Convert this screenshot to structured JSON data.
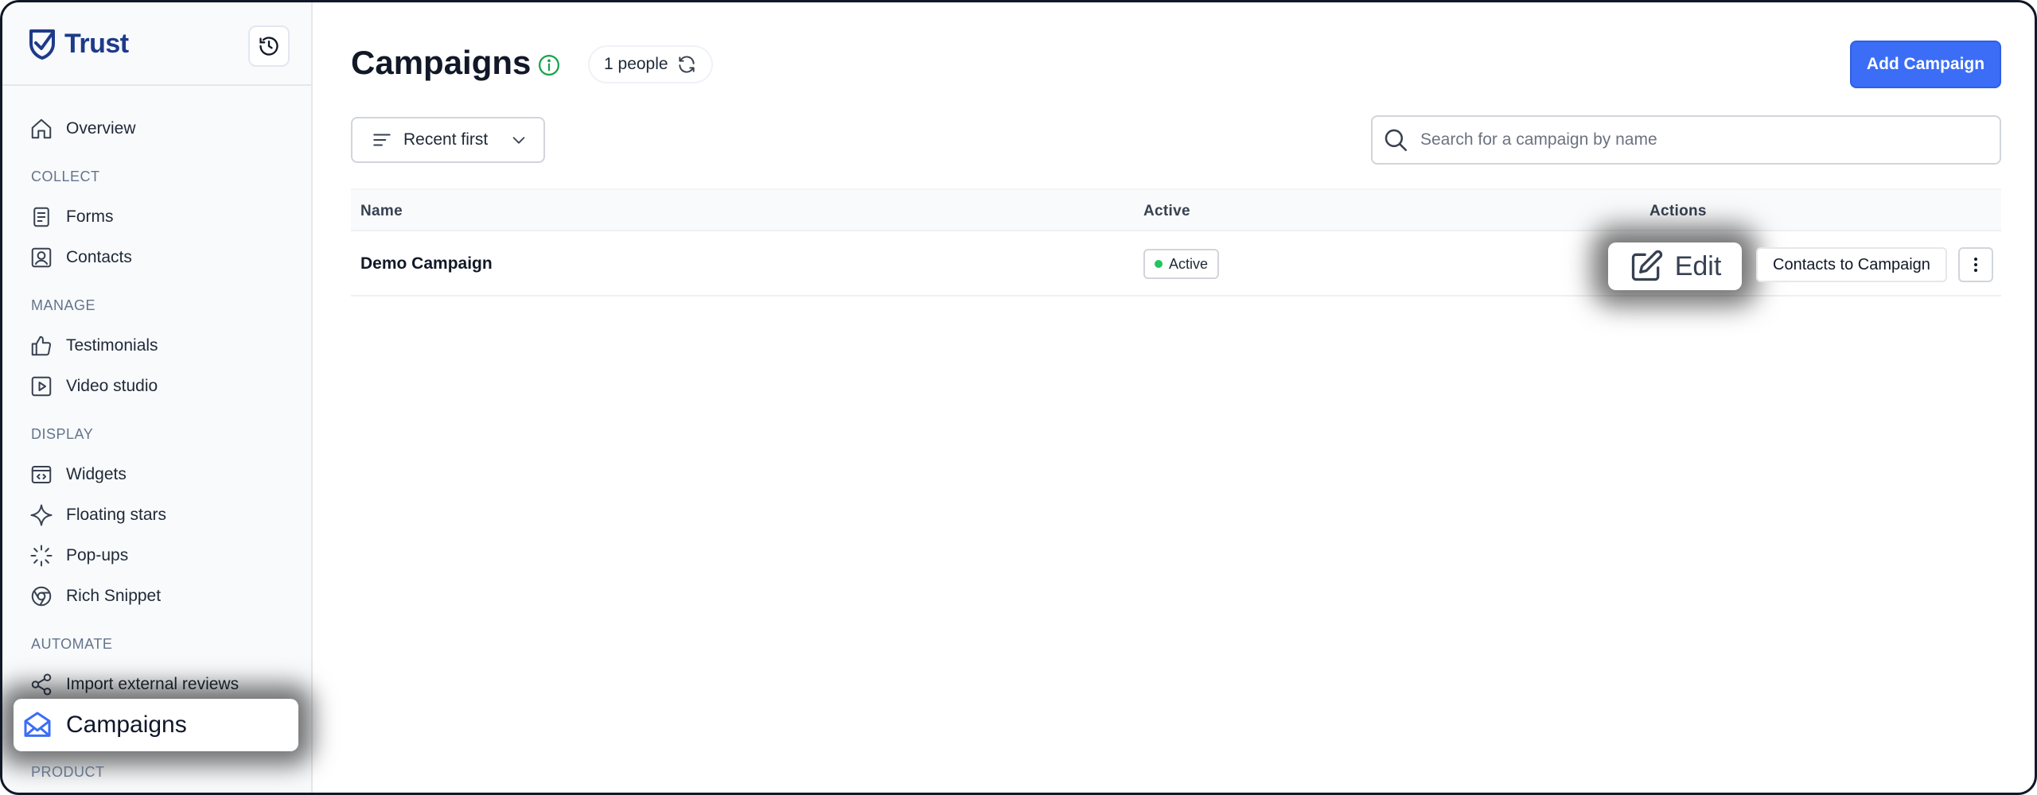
{
  "brand": {
    "name": "Trust",
    "logo_icon": "shield-check-icon"
  },
  "sidebar": {
    "history_icon": "history-clock-icon",
    "overview": {
      "label": "Overview",
      "icon": "home-icon"
    },
    "sections": {
      "collect": "COLLECT",
      "manage": "MANAGE",
      "display": "DISPLAY",
      "automate": "AUTOMATE",
      "product": "PRODUCT"
    },
    "items": {
      "forms": {
        "label": "Forms",
        "icon": "document-icon"
      },
      "contacts": {
        "label": "Contacts",
        "icon": "contact-card-icon"
      },
      "testimonials": {
        "label": "Testimonials",
        "icon": "thumbs-up-icon"
      },
      "video_studio": {
        "label": "Video studio",
        "icon": "play-square-icon"
      },
      "widgets": {
        "label": "Widgets",
        "icon": "code-window-icon"
      },
      "floating_stars": {
        "label": "Floating stars",
        "icon": "sparkle-icon"
      },
      "popups": {
        "label": "Pop-ups",
        "icon": "loader-icon"
      },
      "rich_snippet": {
        "label": "Rich Snippet",
        "icon": "chrome-icon"
      },
      "import_reviews": {
        "label": "Import external reviews",
        "icon": "share-icon"
      },
      "campaigns": {
        "label": "Campaigns",
        "icon": "envelope-icon"
      }
    }
  },
  "header": {
    "title": "Campaigns",
    "people_chip": "1 people",
    "add_button": "Add Campaign"
  },
  "toolbar": {
    "sort_label": "Recent first",
    "search_placeholder": "Search for a campaign by name",
    "search_value": ""
  },
  "table": {
    "columns": {
      "name": "Name",
      "active": "Active",
      "actions": "Actions"
    },
    "rows": [
      {
        "name": "Demo Campaign",
        "status": "Active",
        "edit_label": "Edit",
        "contacts_label": "Contacts to Campaign"
      }
    ]
  },
  "colors": {
    "accent": "#3b6df6",
    "brand": "#1e3a8a",
    "status_active": "#22c55e",
    "info": "#16a34a"
  }
}
